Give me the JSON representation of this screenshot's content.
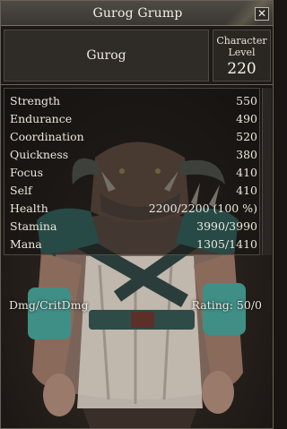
{
  "window": {
    "title": "Gurog Grump",
    "close_glyph": "✕"
  },
  "header": {
    "name": "Gurog",
    "level_label_line1": "Character",
    "level_label_line2": "Level",
    "level_value": "220"
  },
  "stats": [
    {
      "label": "Strength",
      "value": "550"
    },
    {
      "label": "Endurance",
      "value": "490"
    },
    {
      "label": "Coordination",
      "value": "520"
    },
    {
      "label": "Quickness",
      "value": "380"
    },
    {
      "label": "Focus",
      "value": "410"
    },
    {
      "label": "Self",
      "value": "410"
    },
    {
      "label": "Health",
      "value": "2200/2200 (100 %)"
    },
    {
      "label": "Stamina",
      "value": "3990/3990"
    },
    {
      "label": "Mana",
      "value": "1305/1410"
    }
  ],
  "damage": {
    "label": "Dmg/CritDmg",
    "rating": "Rating: 50/0"
  },
  "colors": {
    "title_bar": "#4e4a44",
    "panel_border": "#6a6258",
    "text": "#ece8de",
    "armor_teal": "#3f8f87",
    "creature_skin": "#8a6a5a"
  }
}
